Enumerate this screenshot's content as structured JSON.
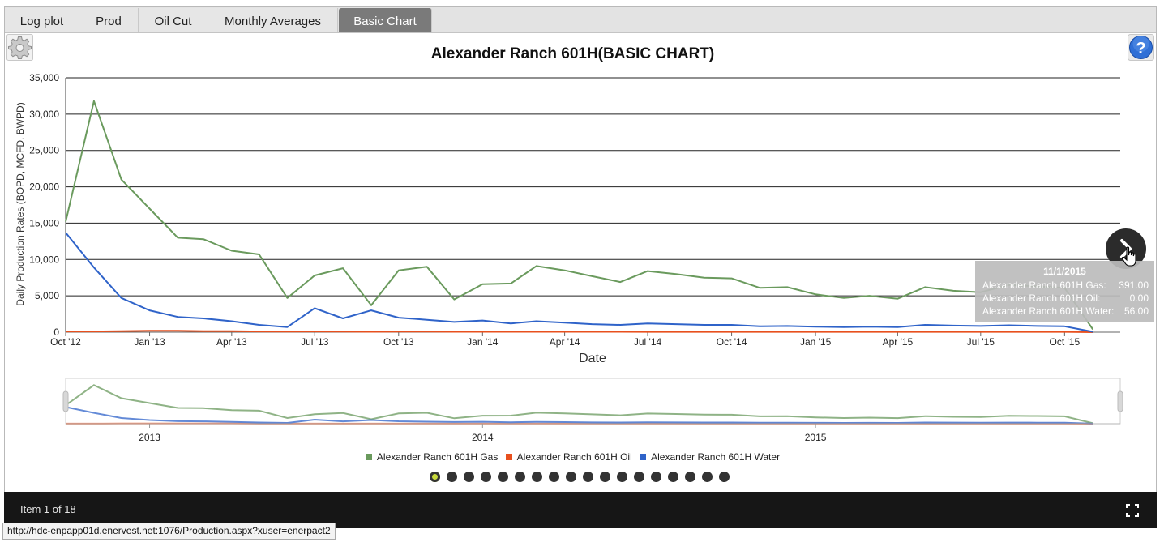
{
  "tabs": [
    {
      "label": "Log plot",
      "active": false
    },
    {
      "label": "Prod",
      "active": false
    },
    {
      "label": "Oil Cut",
      "active": false
    },
    {
      "label": "Monthly Averages",
      "active": false
    },
    {
      "label": "Basic Chart",
      "active": true
    }
  ],
  "icons": {
    "settings": "gear-icon",
    "help": "question-mark-icon",
    "next": "chevron-right-icon",
    "fullscreen": "expand-icon",
    "cursor": "hand-pointer-icon"
  },
  "chart_data": {
    "type": "line",
    "title": "Alexander Ranch 601H(BASIC CHART)",
    "xlabel": "Date",
    "ylabel": "Daily Production Rates (BOPD, MCFD, BWPD)",
    "ylim": [
      0,
      35000
    ],
    "yticks": [
      "0",
      "5,000",
      "10,000",
      "15,000",
      "20,000",
      "25,000",
      "30,000",
      "35,000"
    ],
    "xlim": [
      "2012-10-01",
      "2015-12-01"
    ],
    "xticks": [
      {
        "date": "2012-10-01",
        "label": "Oct '12"
      },
      {
        "date": "2013-01-01",
        "label": "Jan '13"
      },
      {
        "date": "2013-04-01",
        "label": "Apr '13"
      },
      {
        "date": "2013-07-01",
        "label": "Jul '13"
      },
      {
        "date": "2013-10-01",
        "label": "Oct '13"
      },
      {
        "date": "2014-01-01",
        "label": "Jan '14"
      },
      {
        "date": "2014-04-01",
        "label": "Apr '14"
      },
      {
        "date": "2014-07-01",
        "label": "Jul '14"
      },
      {
        "date": "2014-10-01",
        "label": "Oct '14"
      },
      {
        "date": "2015-01-01",
        "label": "Jan '15"
      },
      {
        "date": "2015-04-01",
        "label": "Apr '15"
      },
      {
        "date": "2015-07-01",
        "label": "Jul '15"
      },
      {
        "date": "2015-10-01",
        "label": "Oct '15"
      }
    ],
    "grid": true,
    "legend_position": "bottom",
    "x": [
      "2012-10-01",
      "2012-11-01",
      "2012-12-01",
      "2013-01-01",
      "2013-02-01",
      "2013-03-01",
      "2013-04-01",
      "2013-05-01",
      "2013-06-01",
      "2013-07-01",
      "2013-08-01",
      "2013-09-01",
      "2013-10-01",
      "2013-11-01",
      "2013-12-01",
      "2014-01-01",
      "2014-02-01",
      "2014-03-01",
      "2014-04-01",
      "2014-05-01",
      "2014-06-01",
      "2014-07-01",
      "2014-08-01",
      "2014-09-01",
      "2014-10-01",
      "2014-11-01",
      "2014-12-01",
      "2015-01-01",
      "2015-02-01",
      "2015-03-01",
      "2015-04-01",
      "2015-05-01",
      "2015-06-01",
      "2015-07-01",
      "2015-08-01",
      "2015-09-01",
      "2015-10-01",
      "2015-11-01"
    ],
    "series": [
      {
        "name": "Alexander Ranch 601H Gas",
        "color": "#6a9a5d",
        "values": [
          15200,
          31800,
          21000,
          17000,
          13000,
          12800,
          11200,
          10700,
          4700,
          7800,
          8800,
          3700,
          8500,
          9000,
          4500,
          6600,
          6700,
          9100,
          8500,
          7700,
          6900,
          8400,
          8000,
          7500,
          7400,
          6100,
          6200,
          5200,
          4700,
          5000,
          4600,
          6200,
          5700,
          5500,
          6500,
          6300,
          6100,
          391
        ]
      },
      {
        "name": "Alexander Ranch 601H Oil",
        "color": "#e8501e",
        "values": [
          100,
          100,
          150,
          200,
          200,
          150,
          150,
          100,
          80,
          100,
          80,
          60,
          80,
          80,
          60,
          60,
          60,
          60,
          60,
          60,
          60,
          50,
          50,
          50,
          50,
          50,
          50,
          40,
          40,
          40,
          40,
          40,
          40,
          40,
          40,
          40,
          40,
          0
        ]
      },
      {
        "name": "Alexander Ranch 601H Water",
        "color": "#2f63c9",
        "values": [
          13700,
          8900,
          4700,
          3000,
          2100,
          1900,
          1500,
          1000,
          700,
          3300,
          1900,
          3000,
          2000,
          1700,
          1400,
          1600,
          1200,
          1500,
          1300,
          1100,
          1000,
          1200,
          1100,
          1000,
          1000,
          800,
          850,
          750,
          700,
          750,
          700,
          1000,
          900,
          850,
          950,
          850,
          800,
          56
        ]
      }
    ],
    "navigator_labels": [
      {
        "date": "2013-01-01",
        "label": "2013"
      },
      {
        "date": "2014-01-01",
        "label": "2014"
      },
      {
        "date": "2015-01-01",
        "label": "2015"
      }
    ]
  },
  "tooltip": {
    "date": "11/1/2015",
    "rows": [
      {
        "name": "Alexander Ranch 601H Gas:",
        "value": "391.00"
      },
      {
        "name": "Alexander Ranch 601H Oil:",
        "value": "0.00"
      },
      {
        "name": "Alexander Ranch 601H Water:",
        "value": "56.00"
      }
    ]
  },
  "carousel": {
    "count": 18,
    "active_index": 0
  },
  "footer": {
    "item_text": "Item 1 of 18"
  },
  "status_url": "http://hdc-enpapp01d.enervest.net:1076/Production.aspx?xuser=enerpact2"
}
